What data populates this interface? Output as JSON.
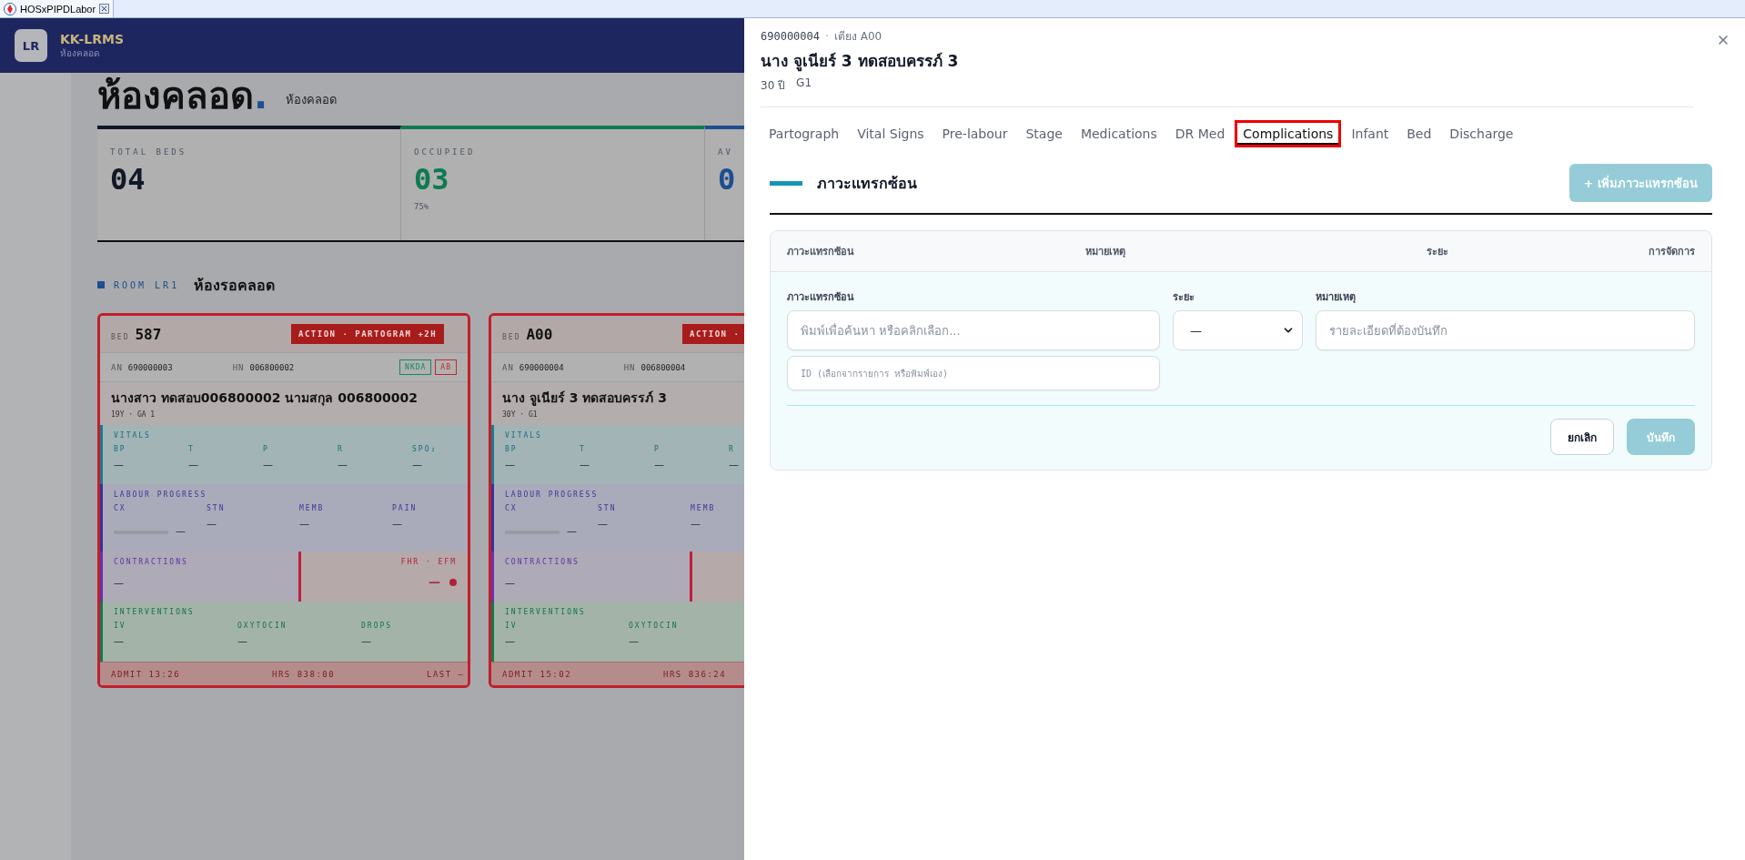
{
  "app_tab": {
    "title": "HOSxPIPDLabor"
  },
  "header": {
    "avatar": "LR",
    "title": "KK-LRMS",
    "subtitle": "ห้องคลอด"
  },
  "page": {
    "title": "ห้องคลอด",
    "title_dot": ".",
    "subtitle": "ห้องคลอด"
  },
  "stats": [
    {
      "label": "TOTAL BEDS",
      "value": "04",
      "color": "#111827"
    },
    {
      "label": "OCCUPIED",
      "value": "03",
      "sub": "75%",
      "color": "#0f7a52"
    },
    {
      "label": "AV",
      "value": "0",
      "color": "#1d4e8f"
    }
  ],
  "room": {
    "code": "ROOM LR1",
    "name": "ห้องรอคลอด"
  },
  "beds": [
    {
      "bed_label": "BED",
      "bed": "587",
      "action": "ACTION · PARTOGRAM +2H",
      "an_label": "AN",
      "an": "690000003",
      "hn_label": "HN",
      "hn": "006800002",
      "tags": [
        {
          "label": "NKDA",
          "color": "#0f8a5f"
        },
        {
          "label": "AB",
          "color": "#c62828"
        }
      ],
      "name": "นางสาว ทดสอบ006800002 นามสกุล 006800002",
      "meta": "19Y · GA 1",
      "sections": [
        {
          "kind": "vitals",
          "title": "VITALS",
          "fields": [
            {
              "label": "BP",
              "value": "—"
            },
            {
              "label": "T",
              "value": "—"
            },
            {
              "label": "P",
              "value": "—"
            },
            {
              "label": "R",
              "value": "—"
            },
            {
              "label": "SPO₂",
              "value": "—"
            }
          ]
        },
        {
          "kind": "labour",
          "title": "LABOUR PROGRESS",
          "fields": [
            {
              "kind": "bar",
              "label": "CX",
              "value": "—",
              "level": 0
            },
            {
              "kind": "text",
              "label": "STN",
              "value": "—"
            },
            {
              "kind": "text",
              "label": "MEMB",
              "value": "—"
            },
            {
              "kind": "text",
              "label": "PAIN",
              "value": "—"
            }
          ]
        },
        {
          "kind": "contractions",
          "title": "CONTRACTIONS",
          "value": "—",
          "fhr_title": "FHR · EFM",
          "fhr_value": "—"
        },
        {
          "kind": "interventions",
          "title": "INTERVENTIONS",
          "fields": [
            {
              "label": "IV",
              "value": "—"
            },
            {
              "label": "OXYTOCIN",
              "value": "—"
            },
            {
              "label": "DROPS",
              "value": "—"
            }
          ]
        }
      ],
      "footer": [
        "ADMIT 13:26",
        "HRS 838:00",
        "LAST —"
      ]
    },
    {
      "bed_label": "BED",
      "bed": "A00",
      "action": "ACTION ·",
      "an_label": "AN",
      "an": "690000004",
      "hn_label": "HN",
      "hn": "006800004",
      "name": "นาง จูเนียร์ 3 ทดสอบครรภ์ 3",
      "meta": "30Y · G1",
      "sections": [
        {
          "kind": "vitals",
          "title": "VITALS",
          "fields": [
            {
              "label": "BP",
              "value": "—"
            },
            {
              "label": "T",
              "value": "—"
            },
            {
              "label": "P",
              "value": "—"
            },
            {
              "label": "R",
              "value": "—"
            }
          ]
        },
        {
          "kind": "labour",
          "title": "LABOUR PROGRESS",
          "fields": [
            {
              "kind": "bar",
              "label": "CX",
              "value": "—",
              "level": 0
            },
            {
              "kind": "text",
              "label": "STN",
              "value": "—"
            },
            {
              "kind": "text",
              "label": "MEMB",
              "value": "—"
            }
          ]
        },
        {
          "kind": "contractions",
          "title": "CONTRACTIONS",
          "value": "—"
        },
        {
          "kind": "interventions",
          "title": "INTERVENTIONS",
          "fields": [
            {
              "label": "IV",
              "value": "—"
            },
            {
              "label": "OXYTOCIN",
              "value": "—"
            }
          ]
        }
      ],
      "footer": [
        "ADMIT 15:02",
        "HRS 836:24"
      ]
    }
  ],
  "drawer": {
    "an": "690000004",
    "separator": "·",
    "bed": "เตียง A00",
    "name": "นาง จูเนียร์ 3 ทดสอบครรภ์ 3",
    "age": "30 ปี",
    "gravida": "G1",
    "tabs": [
      {
        "label": "Partograph",
        "selected": false
      },
      {
        "label": "Vital Signs",
        "selected": false
      },
      {
        "label": "Pre-labour",
        "selected": false
      },
      {
        "label": "Stage",
        "selected": false
      },
      {
        "label": "Medications",
        "selected": false
      },
      {
        "label": "DR Med",
        "selected": false
      },
      {
        "label": "Complications",
        "selected": true
      },
      {
        "label": "Infant",
        "selected": false
      },
      {
        "label": "Bed",
        "selected": false
      },
      {
        "label": "Discharge",
        "selected": false
      }
    ],
    "section_title": "ภาวะแทรกซ้อน",
    "add_button": {
      "label": "+ เพิ่มภาวะแทรกซ้อน",
      "disabled": true
    },
    "table_columns": [
      "ภาวะแทรกซ้อน",
      "หมายเหตุ",
      "ระยะ",
      "การจัดการ"
    ],
    "form": {
      "fields": [
        {
          "kind": "text",
          "label": "ภาวะแทรกซ้อน",
          "placeholder": "พิมพ์เพื่อค้นหา หรือคลิกเลือก...",
          "sub_placeholder": "ID (เลือกจากรายการ หรือพิมพ์เอง)"
        },
        {
          "kind": "select",
          "label": "ระยะ",
          "value": "—"
        },
        {
          "kind": "text",
          "label": "หมายเหตุ",
          "placeholder": "รายละเอียดที่ต้องบันทึก"
        }
      ],
      "cancel": {
        "label": "ยกเลิก",
        "disabled": false
      },
      "save": {
        "label": "บันทึก",
        "disabled": true
      }
    }
  }
}
